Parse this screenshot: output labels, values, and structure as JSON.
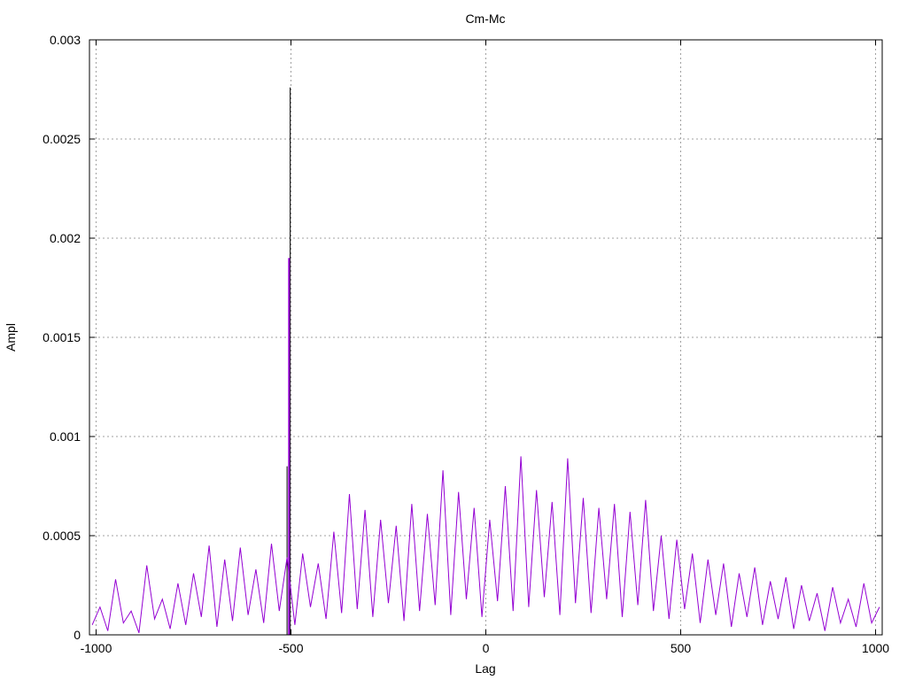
{
  "chart_data": {
    "type": "line",
    "title": "Cm-Mc",
    "xlabel": "Lag",
    "ylabel": "Ampl",
    "xlim": [
      -1017,
      1017
    ],
    "ylim": [
      0,
      0.003
    ],
    "grid": true,
    "xticks": [
      "-1000",
      "-500",
      "0",
      "500",
      "1000"
    ],
    "xtick_values": [
      -1000,
      -500,
      0,
      500,
      1000
    ],
    "yticks": [
      "0",
      "0.0005",
      "0.001",
      "0.0015",
      "0.002",
      "0.0025",
      "0.003"
    ],
    "ytick_values": [
      0,
      0.0005,
      0.001,
      0.0015,
      0.002,
      0.0025,
      0.003
    ],
    "series": [
      {
        "name": "black",
        "color": "#000000",
        "peaks": [
          {
            "x": -510,
            "y": 0.00085
          },
          {
            "x": -502,
            "y": 0.00276
          }
        ]
      },
      {
        "name": "purple",
        "color": "#9400d3",
        "x_start": -1010,
        "x_step": 20,
        "values": [
          5e-05,
          0.00014,
          2e-05,
          0.00028,
          6e-05,
          0.00012,
          1e-05,
          0.00035,
          8e-05,
          0.00018,
          3e-05,
          0.00026,
          5e-05,
          0.00031,
          9e-05,
          0.00045,
          4e-05,
          0.00038,
          7e-05,
          0.00044,
          0.0001,
          0.00033,
          6e-05,
          0.00046,
          0.00012,
          0.00039,
          5e-05,
          0.00041,
          0.00014,
          0.00036,
          8e-05,
          0.00052,
          0.00011,
          0.00071,
          0.00013,
          0.00063,
          9e-05,
          0.00058,
          0.00016,
          0.00055,
          7e-05,
          0.00066,
          0.00012,
          0.00061,
          0.00015,
          0.00083,
          0.0001,
          0.00072,
          0.00018,
          0.00064,
          9e-05,
          0.00058,
          0.00017,
          0.00075,
          0.00012,
          0.0009,
          0.00014,
          0.00073,
          0.00019,
          0.00067,
          0.0001,
          0.00089,
          0.00016,
          0.00069,
          0.00011,
          0.00064,
          0.00018,
          0.00066,
          9e-05,
          0.00062,
          0.00015,
          0.00068,
          0.00012,
          0.0005,
          8e-05,
          0.00048,
          0.00013,
          0.00041,
          6e-05,
          0.00038,
          0.0001,
          0.00036,
          4e-05,
          0.00031,
          9e-05,
          0.00034,
          5e-05,
          0.00027,
          8e-05,
          0.00029,
          3e-05,
          0.00025,
          7e-05,
          0.00021,
          2e-05,
          0.00024,
          6e-05,
          0.00018,
          4e-05,
          0.00026,
          6e-05,
          0.00014
        ],
        "peaks": [
          {
            "x": -505,
            "y": 0.0019
          }
        ]
      }
    ]
  }
}
